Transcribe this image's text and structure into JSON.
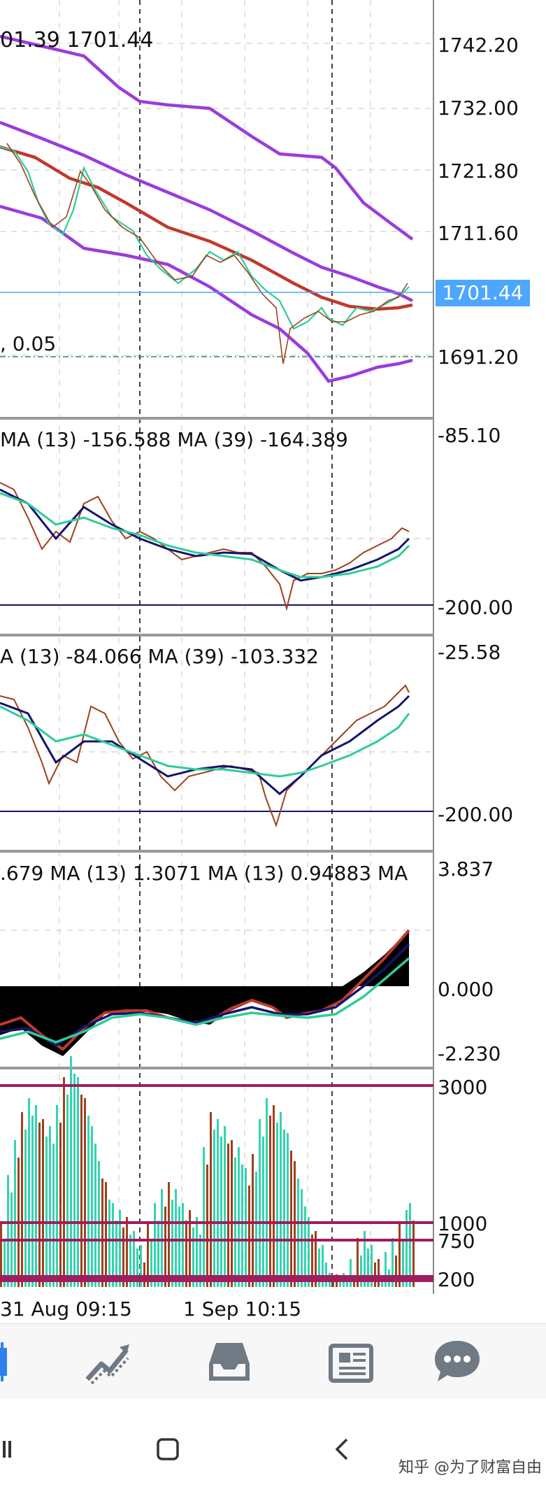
{
  "colors": {
    "accent_blue": "#2f80ed",
    "price_tag_bg": "#4da6ff",
    "ma_purple": "#9b3cdb",
    "ma_red": "#c0392b",
    "ma_navy": "#14146e",
    "ma_teal": "#2ecc9a",
    "volume_teal": "#33d4b0",
    "volume_brown": "#a0401d",
    "level_line": "#a01d5e"
  },
  "main_panel": {
    "header_text": "01.39 1701.44",
    "left_label_top": "",
    "left_label_bottom": ", 0.05",
    "price_tag": "1701.44",
    "y_ticks": [
      "1742.20",
      "1732.00",
      "1721.80",
      "1711.60",
      "1691.20"
    ]
  },
  "panel_2": {
    "header_text": "MA (13)  -156.588 MA (39)  -164.389",
    "y_ticks": [
      "-85.10",
      "-200.00"
    ]
  },
  "panel_3": {
    "header_text": "A (13)  -84.066 MA (39)  -103.332",
    "y_ticks": [
      "-25.58",
      "-200.00"
    ]
  },
  "panel_4": {
    "header_text": ".679 MA (13)  1.3071 MA (13)  0.94883 MA",
    "y_ticks": [
      "3.837",
      "0.000",
      "-2.230"
    ]
  },
  "panel_5": {
    "y_ticks": [
      "3000",
      "1000",
      "750",
      "200"
    ]
  },
  "time_axis": {
    "labels": [
      "31 Aug 09:15",
      "1 Sep 10:15"
    ]
  },
  "nav": {
    "items": [
      "chart-icon",
      "trade-icon",
      "inbox-icon",
      "news-icon",
      "chat-icon"
    ]
  },
  "system_bar": {
    "buttons": [
      "recents-icon",
      "home-icon",
      "back-icon"
    ]
  },
  "watermark": "知乎 @为了财富自由"
}
